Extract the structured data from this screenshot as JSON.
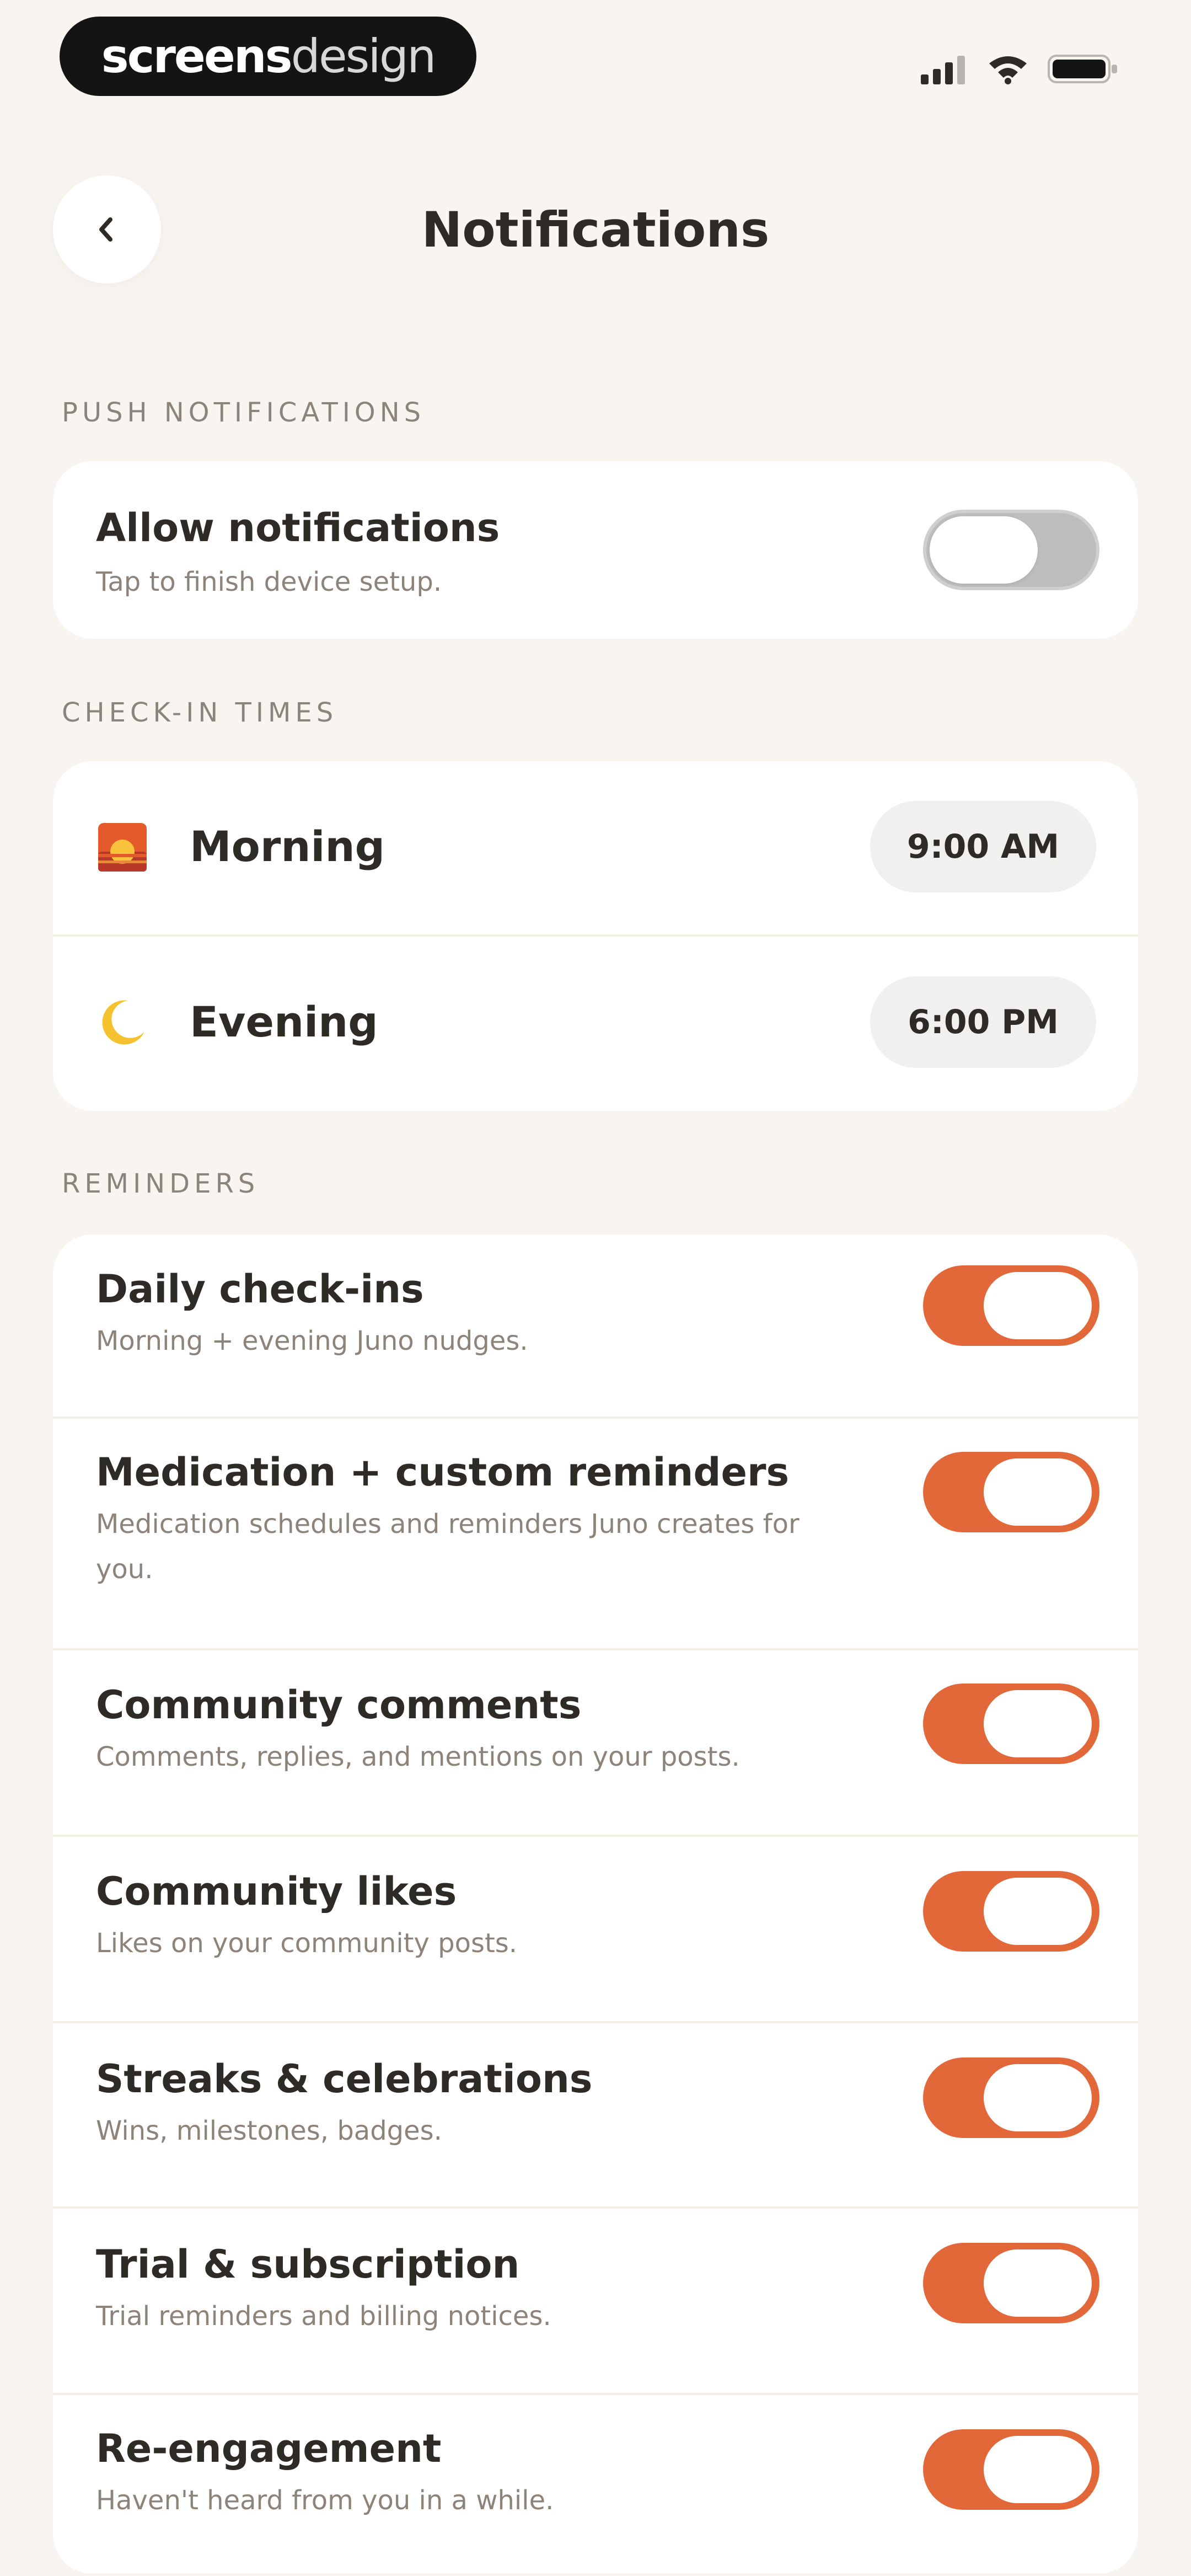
{
  "status_bar": {
    "brand_strong": "screens",
    "brand_light": "design"
  },
  "header": {
    "title": "Notifications"
  },
  "push": {
    "section_label": "PUSH NOTIFICATIONS",
    "allow_title": "Allow notifications",
    "allow_sub": "Tap to finish device setup.",
    "allow_enabled": false
  },
  "checkin": {
    "section_label": "CHECK-IN TIMES",
    "items": [
      {
        "icon": "sunrise-icon",
        "label": "Morning",
        "time": "9:00 AM"
      },
      {
        "icon": "crescent-moon-icon",
        "label": "Evening",
        "time": "6:00 PM"
      }
    ]
  },
  "reminders": {
    "section_label": "REMINDERS",
    "items": [
      {
        "title": "Daily check-ins",
        "sub": "Morning + evening Juno nudges.",
        "enabled": true
      },
      {
        "title": "Medication + custom reminders",
        "sub": "Medication schedules and reminders Juno creates for you.",
        "enabled": true
      },
      {
        "title": "Community comments",
        "sub": "Comments, replies, and mentions on your posts.",
        "enabled": true
      },
      {
        "title": "Community likes",
        "sub": "Likes on your community posts.",
        "enabled": true
      },
      {
        "title": "Streaks & celebrations",
        "sub": "Wins, milestones, badges.",
        "enabled": true
      },
      {
        "title": "Trial & subscription",
        "sub": "Trial reminders and billing notices.",
        "enabled": true
      },
      {
        "title": "Re-engagement",
        "sub": "Haven't heard from you in a while.",
        "enabled": true
      }
    ]
  },
  "colors": {
    "background": "#F8F5F0",
    "accent": "#E2683A",
    "toggle_off": "#BDBDBD",
    "text_primary": "#2E2A26",
    "text_secondary": "#8C847B"
  }
}
